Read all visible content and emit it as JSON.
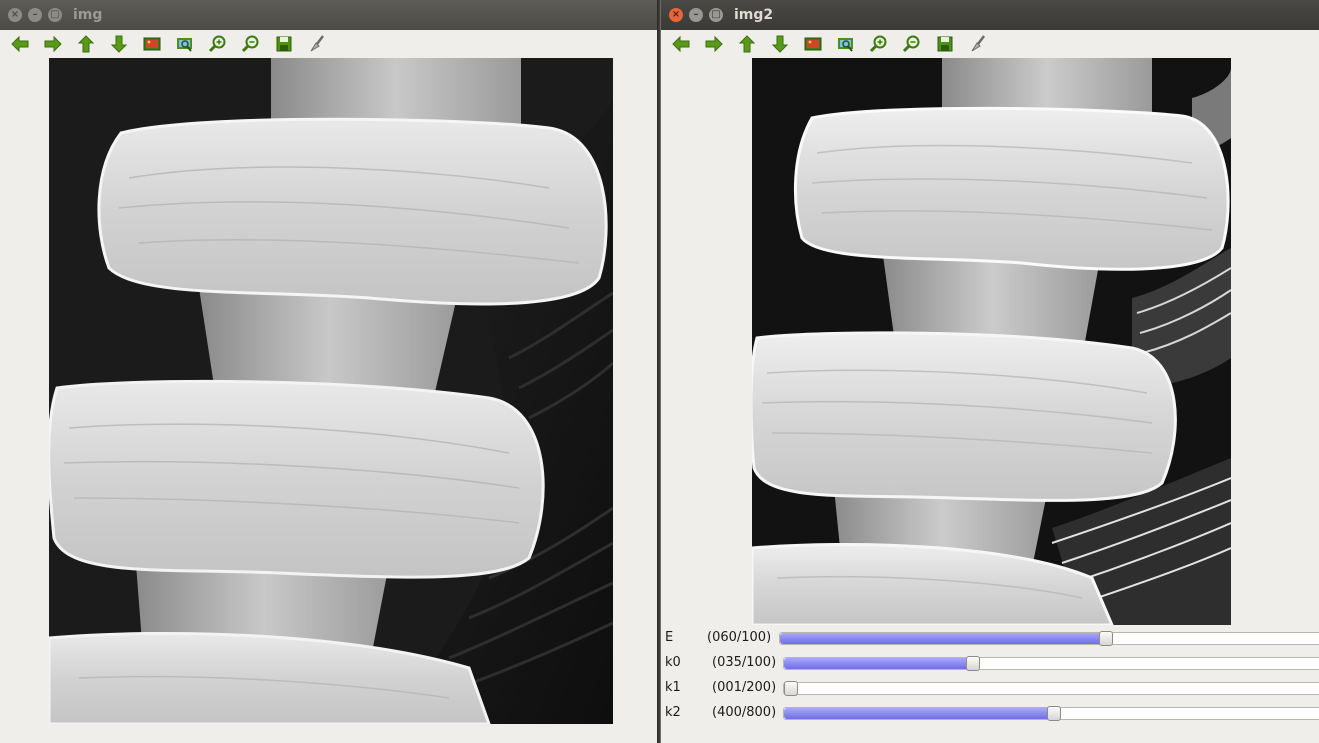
{
  "windows": {
    "img": {
      "title": "img",
      "toolbar": [
        "arrow-left-icon",
        "arrow-right-icon",
        "arrow-up-icon",
        "arrow-down-icon",
        "image-icon",
        "zoom-region-icon",
        "zoom-in-icon",
        "zoom-out-icon",
        "save-icon",
        "properties-icon"
      ]
    },
    "img2": {
      "title": "img2",
      "trackbars": [
        {
          "name": "E",
          "label": "(060/100)",
          "value": 60,
          "max": 100
        },
        {
          "name": "k0",
          "label": "(035/100)",
          "value": 35,
          "max": 100
        },
        {
          "name": "k1",
          "label": "(001/200)",
          "value": 1,
          "max": 200
        },
        {
          "name": "k2",
          "label": "(400/800)",
          "value": 400,
          "max": 800
        }
      ]
    }
  },
  "window_buttons": {
    "close": "×",
    "minimize": "–",
    "maximize": "□"
  },
  "colors": {
    "toolbar_green": "#5a9a1a",
    "trackbar_fill": "#7a7aee",
    "window_bg": "#f0eeeb"
  }
}
